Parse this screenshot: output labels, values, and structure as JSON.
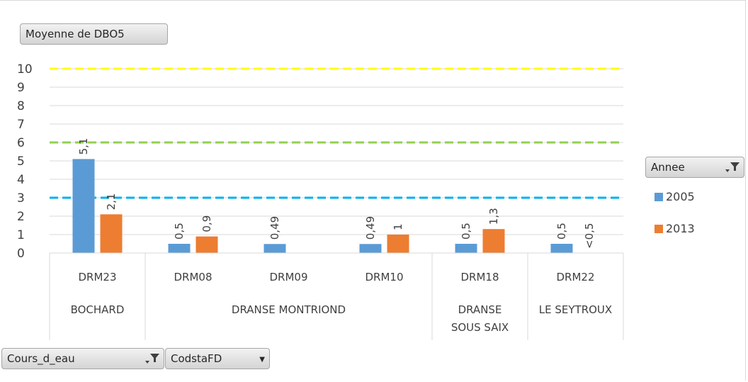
{
  "chart_data": {
    "type": "bar",
    "measure_label": "Moyenne de DBO5",
    "title": "",
    "xlabel": "",
    "ylabel": "",
    "ylim": [
      0,
      10
    ],
    "yticks": [
      "0",
      "1",
      "2",
      "3",
      "4",
      "5",
      "6",
      "7",
      "8",
      "9",
      "10"
    ],
    "categories": [
      "DRM23",
      "DRM08",
      "DRM09",
      "DRM10",
      "DRM18",
      "DRM22"
    ],
    "groups": [
      {
        "label": "BOCHARD",
        "label_lines": [
          "BOCHARD"
        ],
        "stations": [
          "DRM23"
        ]
      },
      {
        "label": "DRANSE MONTRIOND",
        "label_lines": [
          "DRANSE MONTRIOND"
        ],
        "stations": [
          "DRM08",
          "DRM09",
          "DRM10"
        ]
      },
      {
        "label": "DRANSE SOUS SAIX",
        "label_lines": [
          "DRANSE",
          "SOUS SAIX"
        ],
        "stations": [
          "DRM18"
        ]
      },
      {
        "label": "LE SEYTROUX",
        "label_lines": [
          "LE SEYTROUX"
        ],
        "stations": [
          "DRM22"
        ]
      }
    ],
    "series": [
      {
        "name": "2005",
        "color": "#5b9bd5",
        "values": [
          5.1,
          0.5,
          0.49,
          0.49,
          0.5,
          0.5
        ],
        "labels": [
          "5,1",
          "0,5",
          "0,49",
          "0,49",
          "0,5",
          "0,5"
        ]
      },
      {
        "name": "2013",
        "color": "#ed7d31",
        "values": [
          2.1,
          0.9,
          null,
          1,
          1.3,
          null
        ],
        "labels": [
          "2,1",
          "0,9",
          "",
          "1",
          "1,3",
          "<0,5"
        ]
      }
    ],
    "reference_lines": [
      {
        "value": 10,
        "color": "#ffff00"
      },
      {
        "value": 6,
        "color": "#92d050"
      },
      {
        "value": 3,
        "color": "#00b0f0"
      }
    ],
    "grid": true,
    "legend_position": "right"
  },
  "legend": {
    "field_label": "Annee"
  },
  "axis_fields": {
    "course_label": "Cours_d_eau",
    "station_label": "CodstaFD"
  }
}
